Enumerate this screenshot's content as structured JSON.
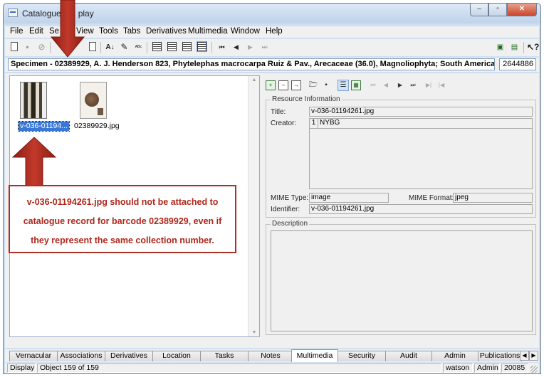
{
  "window": {
    "title": "Catalogue (1   play",
    "minimize": "–",
    "maximize": "▫",
    "close": "✕"
  },
  "menu": [
    "File",
    "Edit",
    "Se",
    "View",
    "Tools",
    "Tabs",
    "Derivatives",
    "Multimedia",
    "Window",
    "Help"
  ],
  "record": {
    "summary": "Specimen - 02389929, A. J. Henderson 823, Phytelephas macrocarpa Ruiz & Pav., Arecaceae (36.0), Magnoliophyta;  South America, Brazil, Ama:",
    "id": "2644886"
  },
  "thumbnails": [
    {
      "label": "v-036-01194...",
      "selected": true
    },
    {
      "label": "02389929.jpg",
      "selected": false
    }
  ],
  "resource": {
    "legend": "Resource Information",
    "title_label": "Title:",
    "title_value": "v-036-01194261.jpg",
    "creator_label": "Creator:",
    "creator_index": "1",
    "creator_value": "NYBG",
    "mime_type_label": "MIME Type:",
    "mime_type_value": "image",
    "mime_format_label": "MIME Format:",
    "mime_format_value": "jpeg",
    "identifier_label": "Identifier:",
    "identifier_value": "v-036-01194261.jpg"
  },
  "description": {
    "legend": "Description"
  },
  "annotation": {
    "line1": "v-036-01194261.jpg     should not be attached to",
    "line2": "catalogue record for barcode 02389929,   even if",
    "line3": "they represent the same collection number.",
    "color": "#b0261a"
  },
  "tabs": [
    "Vernacular",
    "Associations",
    "Derivatives",
    "Location",
    "Tasks",
    "Notes",
    "Multimedia",
    "Security",
    "Audit",
    "Admin",
    "Publications"
  ],
  "active_tab": "Multimedia",
  "status": {
    "mode": "Display",
    "object": "Object 159 of 159",
    "user": "watson",
    "role": "Admin",
    "code": "20085"
  }
}
